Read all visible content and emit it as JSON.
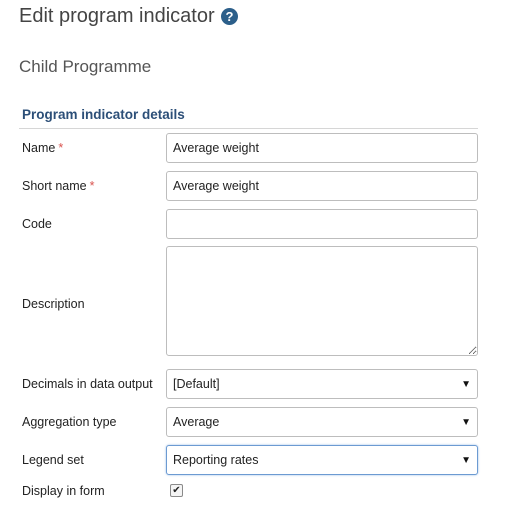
{
  "page": {
    "title": "Edit program indicator",
    "help_icon": "question-circle-icon",
    "program_name": "Child Programme",
    "accent_color": "#2c4f78"
  },
  "section": {
    "header": "Program indicator details"
  },
  "form": {
    "name": {
      "label": "Name",
      "required_mark": "*",
      "value": "Average weight"
    },
    "short_name": {
      "label": "Short name",
      "required_mark": "*",
      "value": "Average weight"
    },
    "code": {
      "label": "Code",
      "value": ""
    },
    "description": {
      "label": "Description",
      "value": ""
    },
    "decimals": {
      "label": "Decimals in data output",
      "selected": "[Default]"
    },
    "aggregation_type": {
      "label": "Aggregation type",
      "selected": "Average"
    },
    "legend_set": {
      "label": "Legend set",
      "selected": "Reporting rates"
    },
    "display_in_form": {
      "label": "Display in form",
      "checked": true,
      "check_glyph": "✔"
    }
  },
  "dropdown_caret": "▼"
}
